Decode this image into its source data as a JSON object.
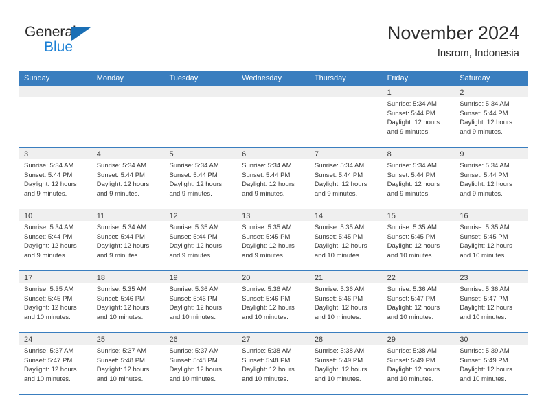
{
  "logo": {
    "primary_text": "General",
    "secondary_text": "Blue",
    "triangle_color": "#1a6fb5",
    "secondary_color": "#1a7fd4"
  },
  "header": {
    "title": "November 2024",
    "subtitle": "Insrom, Indonesia"
  },
  "theme": {
    "header_bar": "#3a7ebf",
    "daynum_strip": "#efefef",
    "text": "#353535"
  },
  "weekdays": [
    "Sunday",
    "Monday",
    "Tuesday",
    "Wednesday",
    "Thursday",
    "Friday",
    "Saturday"
  ],
  "labels": {
    "sunrise": "Sunrise:",
    "sunset": "Sunset:",
    "daylight": "Daylight:"
  },
  "weeks": [
    [
      {
        "day": "",
        "empty": true
      },
      {
        "day": "",
        "empty": true
      },
      {
        "day": "",
        "empty": true
      },
      {
        "day": "",
        "empty": true
      },
      {
        "day": "",
        "empty": true
      },
      {
        "day": "1",
        "sunrise": "Sunrise: 5:34 AM",
        "sunset": "Sunset: 5:44 PM",
        "daylight1": "Daylight: 12 hours",
        "daylight2": "and 9 minutes."
      },
      {
        "day": "2",
        "sunrise": "Sunrise: 5:34 AM",
        "sunset": "Sunset: 5:44 PM",
        "daylight1": "Daylight: 12 hours",
        "daylight2": "and 9 minutes."
      }
    ],
    [
      {
        "day": "3",
        "sunrise": "Sunrise: 5:34 AM",
        "sunset": "Sunset: 5:44 PM",
        "daylight1": "Daylight: 12 hours",
        "daylight2": "and 9 minutes."
      },
      {
        "day": "4",
        "sunrise": "Sunrise: 5:34 AM",
        "sunset": "Sunset: 5:44 PM",
        "daylight1": "Daylight: 12 hours",
        "daylight2": "and 9 minutes."
      },
      {
        "day": "5",
        "sunrise": "Sunrise: 5:34 AM",
        "sunset": "Sunset: 5:44 PM",
        "daylight1": "Daylight: 12 hours",
        "daylight2": "and 9 minutes."
      },
      {
        "day": "6",
        "sunrise": "Sunrise: 5:34 AM",
        "sunset": "Sunset: 5:44 PM",
        "daylight1": "Daylight: 12 hours",
        "daylight2": "and 9 minutes."
      },
      {
        "day": "7",
        "sunrise": "Sunrise: 5:34 AM",
        "sunset": "Sunset: 5:44 PM",
        "daylight1": "Daylight: 12 hours",
        "daylight2": "and 9 minutes."
      },
      {
        "day": "8",
        "sunrise": "Sunrise: 5:34 AM",
        "sunset": "Sunset: 5:44 PM",
        "daylight1": "Daylight: 12 hours",
        "daylight2": "and 9 minutes."
      },
      {
        "day": "9",
        "sunrise": "Sunrise: 5:34 AM",
        "sunset": "Sunset: 5:44 PM",
        "daylight1": "Daylight: 12 hours",
        "daylight2": "and 9 minutes."
      }
    ],
    [
      {
        "day": "10",
        "sunrise": "Sunrise: 5:34 AM",
        "sunset": "Sunset: 5:44 PM",
        "daylight1": "Daylight: 12 hours",
        "daylight2": "and 9 minutes."
      },
      {
        "day": "11",
        "sunrise": "Sunrise: 5:34 AM",
        "sunset": "Sunset: 5:44 PM",
        "daylight1": "Daylight: 12 hours",
        "daylight2": "and 9 minutes."
      },
      {
        "day": "12",
        "sunrise": "Sunrise: 5:35 AM",
        "sunset": "Sunset: 5:44 PM",
        "daylight1": "Daylight: 12 hours",
        "daylight2": "and 9 minutes."
      },
      {
        "day": "13",
        "sunrise": "Sunrise: 5:35 AM",
        "sunset": "Sunset: 5:45 PM",
        "daylight1": "Daylight: 12 hours",
        "daylight2": "and 9 minutes."
      },
      {
        "day": "14",
        "sunrise": "Sunrise: 5:35 AM",
        "sunset": "Sunset: 5:45 PM",
        "daylight1": "Daylight: 12 hours",
        "daylight2": "and 10 minutes."
      },
      {
        "day": "15",
        "sunrise": "Sunrise: 5:35 AM",
        "sunset": "Sunset: 5:45 PM",
        "daylight1": "Daylight: 12 hours",
        "daylight2": "and 10 minutes."
      },
      {
        "day": "16",
        "sunrise": "Sunrise: 5:35 AM",
        "sunset": "Sunset: 5:45 PM",
        "daylight1": "Daylight: 12 hours",
        "daylight2": "and 10 minutes."
      }
    ],
    [
      {
        "day": "17",
        "sunrise": "Sunrise: 5:35 AM",
        "sunset": "Sunset: 5:45 PM",
        "daylight1": "Daylight: 12 hours",
        "daylight2": "and 10 minutes."
      },
      {
        "day": "18",
        "sunrise": "Sunrise: 5:35 AM",
        "sunset": "Sunset: 5:46 PM",
        "daylight1": "Daylight: 12 hours",
        "daylight2": "and 10 minutes."
      },
      {
        "day": "19",
        "sunrise": "Sunrise: 5:36 AM",
        "sunset": "Sunset: 5:46 PM",
        "daylight1": "Daylight: 12 hours",
        "daylight2": "and 10 minutes."
      },
      {
        "day": "20",
        "sunrise": "Sunrise: 5:36 AM",
        "sunset": "Sunset: 5:46 PM",
        "daylight1": "Daylight: 12 hours",
        "daylight2": "and 10 minutes."
      },
      {
        "day": "21",
        "sunrise": "Sunrise: 5:36 AM",
        "sunset": "Sunset: 5:46 PM",
        "daylight1": "Daylight: 12 hours",
        "daylight2": "and 10 minutes."
      },
      {
        "day": "22",
        "sunrise": "Sunrise: 5:36 AM",
        "sunset": "Sunset: 5:47 PM",
        "daylight1": "Daylight: 12 hours",
        "daylight2": "and 10 minutes."
      },
      {
        "day": "23",
        "sunrise": "Sunrise: 5:36 AM",
        "sunset": "Sunset: 5:47 PM",
        "daylight1": "Daylight: 12 hours",
        "daylight2": "and 10 minutes."
      }
    ],
    [
      {
        "day": "24",
        "sunrise": "Sunrise: 5:37 AM",
        "sunset": "Sunset: 5:47 PM",
        "daylight1": "Daylight: 12 hours",
        "daylight2": "and 10 minutes."
      },
      {
        "day": "25",
        "sunrise": "Sunrise: 5:37 AM",
        "sunset": "Sunset: 5:48 PM",
        "daylight1": "Daylight: 12 hours",
        "daylight2": "and 10 minutes."
      },
      {
        "day": "26",
        "sunrise": "Sunrise: 5:37 AM",
        "sunset": "Sunset: 5:48 PM",
        "daylight1": "Daylight: 12 hours",
        "daylight2": "and 10 minutes."
      },
      {
        "day": "27",
        "sunrise": "Sunrise: 5:38 AM",
        "sunset": "Sunset: 5:48 PM",
        "daylight1": "Daylight: 12 hours",
        "daylight2": "and 10 minutes."
      },
      {
        "day": "28",
        "sunrise": "Sunrise: 5:38 AM",
        "sunset": "Sunset: 5:49 PM",
        "daylight1": "Daylight: 12 hours",
        "daylight2": "and 10 minutes."
      },
      {
        "day": "29",
        "sunrise": "Sunrise: 5:38 AM",
        "sunset": "Sunset: 5:49 PM",
        "daylight1": "Daylight: 12 hours",
        "daylight2": "and 10 minutes."
      },
      {
        "day": "30",
        "sunrise": "Sunrise: 5:39 AM",
        "sunset": "Sunset: 5:49 PM",
        "daylight1": "Daylight: 12 hours",
        "daylight2": "and 10 minutes."
      }
    ]
  ]
}
